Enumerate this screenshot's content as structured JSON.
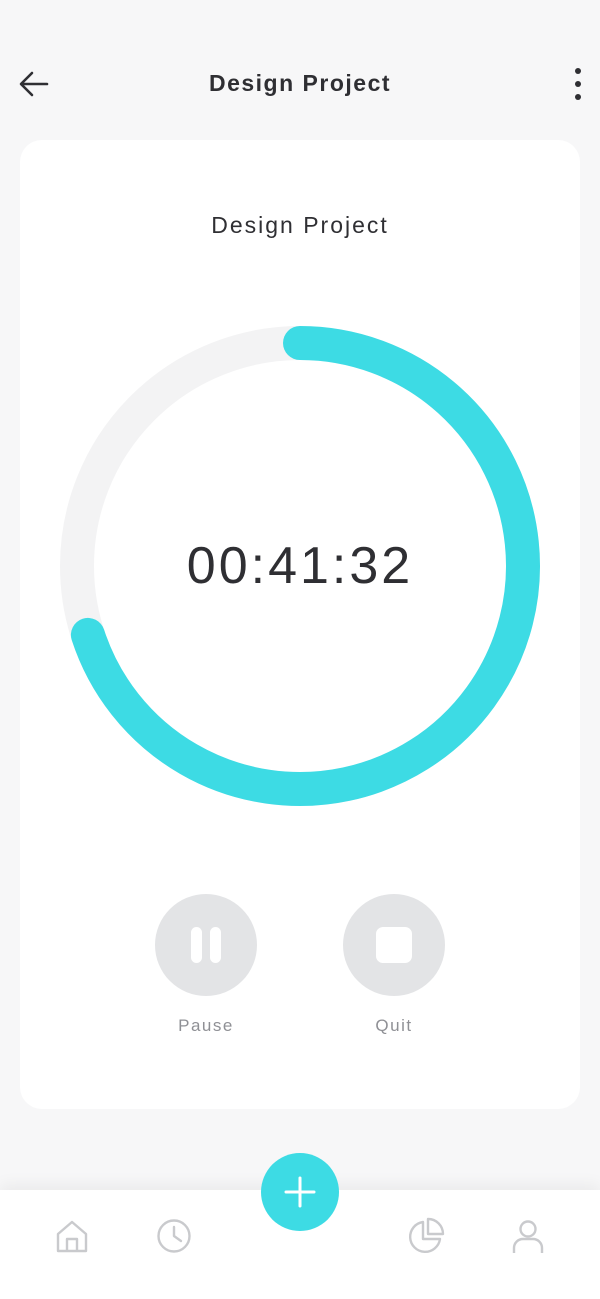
{
  "header": {
    "title": "Design Project",
    "back_icon": "arrow-left-icon",
    "more_icon": "more-vertical-icon"
  },
  "card": {
    "title": "Design Project",
    "timer": {
      "elapsed": "00:41:32",
      "progress": 0.7,
      "progress_color": "#3ddbe4",
      "track_color": "#f3f3f4"
    }
  },
  "controls": {
    "pause_label": "Pause",
    "quit_label": "Quit",
    "button_color": "#e3e4e6"
  },
  "bottom_nav": {
    "items": [
      {
        "icon": "home-icon"
      },
      {
        "icon": "clock-icon"
      },
      {
        "icon": "pie-chart-icon"
      },
      {
        "icon": "user-icon"
      }
    ],
    "fab_icon": "plus-icon",
    "fab_color": "#3ddbe4"
  }
}
